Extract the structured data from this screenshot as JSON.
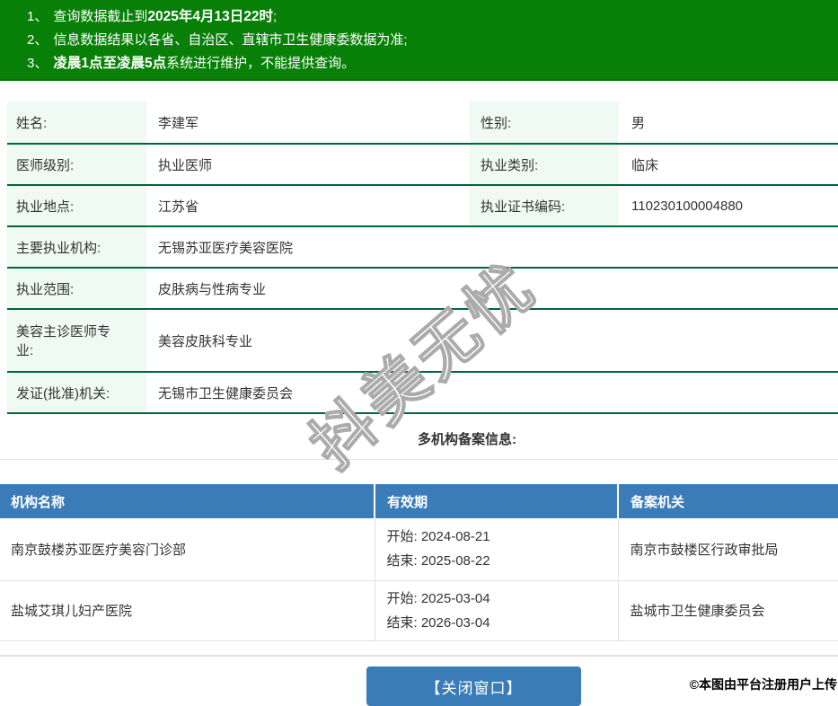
{
  "notice_bar": {
    "n1": {
      "num": "1、",
      "pre": "查询数据截止到",
      "bold": "2025年4月13日22时",
      "post": ";"
    },
    "n2": {
      "num": "2、",
      "pre": "信息数据结果以各省、自治区、直辖市卫生健康委数据为准;"
    },
    "n3": {
      "num": "3、",
      "bold": "凌晨1点至凌晨5点",
      "post": "系统进行维护，不能提供查询。"
    }
  },
  "doctor": {
    "row1": {
      "l1": "姓名:",
      "v1": "李建军",
      "l2": "性别:",
      "v2": "男"
    },
    "row2": {
      "l1": "医师级别:",
      "v1": "执业医师",
      "l2": "执业类别:",
      "v2": "临床"
    },
    "row3": {
      "l1": "执业地点:",
      "v1": "江苏省",
      "l2": "执业证书编码:",
      "v2": "110230100004880"
    },
    "row4": {
      "l1": "主要执业机构:",
      "v1": "无锡苏亚医疗美容医院"
    },
    "row5": {
      "l1": "执业范围:",
      "v1": "皮肤病与性病专业"
    },
    "row6": {
      "l1": "美容主诊医师专业:",
      "v1": "美容皮肤科专业"
    },
    "row7": {
      "l1": "发证(批准)机关:",
      "v1": "无锡市卫生健康委员会"
    }
  },
  "section_title": "多机构备案信息:",
  "org_table": {
    "headers": [
      "机构名称",
      "有效期",
      "备案机关"
    ],
    "rows": [
      {
        "name": "南京鼓楼苏亚医疗美容门诊部",
        "start_label": "开始:",
        "start_date": "2024-08-21",
        "end_label": "结束:",
        "end_date": "2025-08-22",
        "authority": "南京市鼓楼区行政审批局"
      },
      {
        "name": "盐城艾琪儿妇产医院",
        "start_label": "开始:",
        "start_date": "2025-03-04",
        "end_label": "结束:",
        "end_date": "2026-03-04",
        "authority": "盐城市卫生健康委员会"
      }
    ]
  },
  "close_button_label": "【关闭窗口】",
  "watermark_text": "抖美无忧",
  "credit_text": "©本图由平台注册用户上传",
  "colors": {
    "notice_green": "#088008",
    "row_border_green": "#00663a",
    "label_bg_green": "#eefaf3",
    "table_header_blue": "#3a7cb8",
    "button_blue": "#3a7cb8"
  }
}
